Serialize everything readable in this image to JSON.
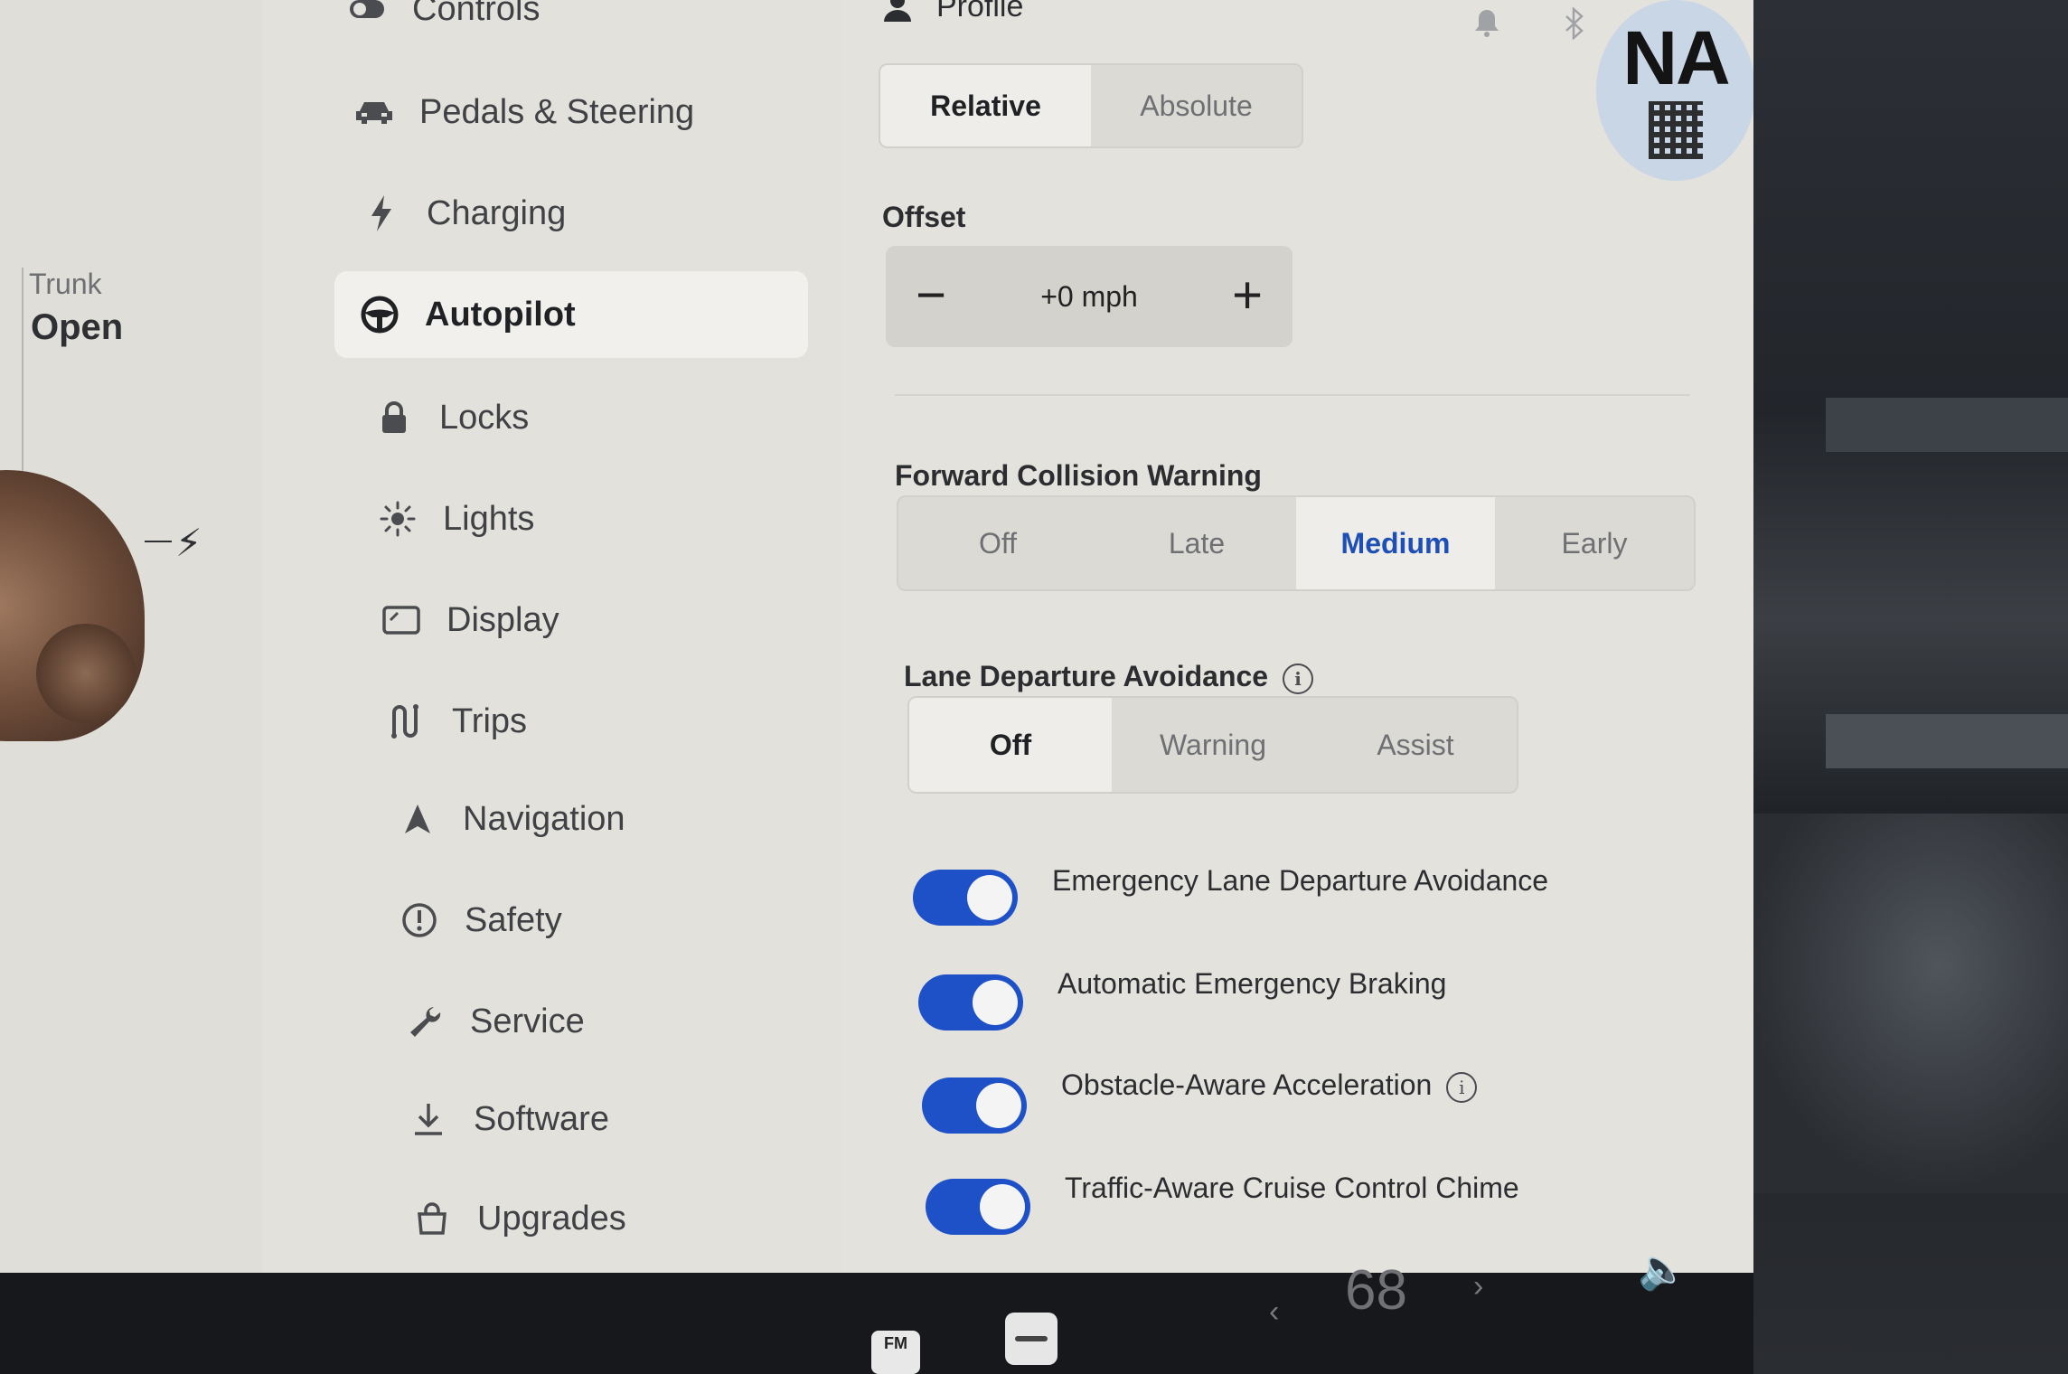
{
  "car": {
    "trunk_label": "Trunk",
    "trunk_value": "Open"
  },
  "menu": {
    "items": [
      {
        "label": "Controls",
        "icon": "toggle-icon"
      },
      {
        "label": "Pedals & Steering",
        "icon": "car-icon"
      },
      {
        "label": "Charging",
        "icon": "bolt-icon"
      },
      {
        "label": "Autopilot",
        "icon": "steering-wheel-icon",
        "active": true
      },
      {
        "label": "Locks",
        "icon": "lock-icon"
      },
      {
        "label": "Lights",
        "icon": "sun-icon"
      },
      {
        "label": "Display",
        "icon": "display-icon"
      },
      {
        "label": "Trips",
        "icon": "trips-icon"
      },
      {
        "label": "Navigation",
        "icon": "navigation-arrow-icon"
      },
      {
        "label": "Safety",
        "icon": "alert-circle-icon"
      },
      {
        "label": "Service",
        "icon": "wrench-icon"
      },
      {
        "label": "Software",
        "icon": "download-icon"
      },
      {
        "label": "Upgrades",
        "icon": "bag-icon"
      }
    ]
  },
  "header": {
    "profile_label": "Profile"
  },
  "speed_limit_mode": {
    "options": [
      "Relative",
      "Absolute"
    ],
    "selected": "Relative"
  },
  "offset": {
    "label": "Offset",
    "value": "+0 mph",
    "minus": "−",
    "plus": "+"
  },
  "forward_collision": {
    "label": "Forward Collision Warning",
    "options": [
      "Off",
      "Late",
      "Medium",
      "Early"
    ],
    "selected": "Medium"
  },
  "lane_departure": {
    "label": "Lane Departure Avoidance",
    "options": [
      "Off",
      "Warning",
      "Assist"
    ],
    "selected": "Off"
  },
  "toggles": [
    {
      "label": "Emergency Lane Departure Avoidance",
      "on": true
    },
    {
      "label": "Automatic Emergency Braking",
      "on": true
    },
    {
      "label": "Obstacle-Aware Acceleration",
      "on": true
    },
    {
      "label": "Traffic-Aware Cruise Control Chime",
      "on": true
    }
  ],
  "sticker": {
    "text": "NA"
  },
  "dock": {
    "temperature": "68",
    "fm_label": "FM"
  },
  "colors": {
    "accent": "#1e50c8",
    "selected_text": "#1e4fb5",
    "background": "#e4e2dd"
  }
}
